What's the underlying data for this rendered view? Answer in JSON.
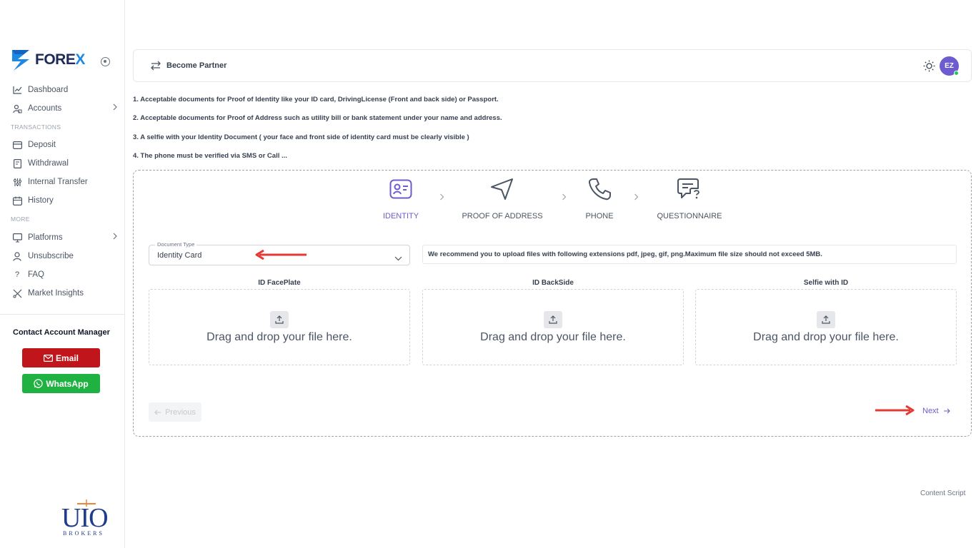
{
  "sidebar": {
    "logo_prefix": "FORE",
    "logo_x": "X",
    "items": [
      {
        "label": "Dashboard",
        "icon": "chart-icon"
      },
      {
        "label": "Accounts",
        "icon": "user-lock-icon"
      },
      {
        "label": "Deposit",
        "icon": "card-icon"
      },
      {
        "label": "Withdrawal",
        "icon": "receipt-icon"
      },
      {
        "label": "Internal Transfer",
        "icon": "sliders-icon"
      },
      {
        "label": "History",
        "icon": "calendar-icon"
      },
      {
        "label": "Platforms",
        "icon": "monitor-icon"
      },
      {
        "label": "Unsubscribe",
        "icon": "user-icon"
      },
      {
        "label": "FAQ",
        "icon": "question-icon"
      },
      {
        "label": "Market Insights",
        "icon": "tools-icon"
      }
    ],
    "section_transactions": "TRANSACTIONS",
    "section_more": "MORE",
    "contact_title": "Contact Account Manager",
    "email_label": "Email",
    "whatsapp_label": "WhatsApp",
    "brand_text": "UIO",
    "brand_sub": "BROKERS"
  },
  "header": {
    "become_partner": "Become Partner",
    "avatar_initials": "EZ"
  },
  "notes": [
    "1. Acceptable documents for Proof of Identity like your ID card, DrivingLicense (Front and back side) or Passport.",
    "2. Acceptable documents for Proof of Address such as utility bill or bank statement under your name and address.",
    "3. A selfie with your Identity Document ( your face and front side of identity card must be clearly visible )",
    "4. The phone must be verified via SMS or Call ..."
  ],
  "steps": [
    {
      "label": "IDENTITY",
      "icon": "id-card-icon",
      "active": true
    },
    {
      "label": "PROOF OF ADDRESS",
      "icon": "navigation-icon",
      "active": false
    },
    {
      "label": "PHONE",
      "icon": "phone-icon",
      "active": false
    },
    {
      "label": "QUESTIONNAIRE",
      "icon": "message-question-icon",
      "active": false
    }
  ],
  "document_type": {
    "legend": "Document Type",
    "value": "Identity Card"
  },
  "recommendation": "We recommend you to upload files with following extensions pdf, jpeg, gif, png.Maximum file size should not exceed 5MB.",
  "uploads": [
    {
      "label": "ID FacePlate",
      "drop_text": "Drag and drop your file here."
    },
    {
      "label": "ID BackSide",
      "drop_text": "Drag and drop your file here."
    },
    {
      "label": "Selfie with ID",
      "drop_text": "Drag and drop your file here."
    }
  ],
  "nav_buttons": {
    "previous": "Previous",
    "next": "Next"
  },
  "footer": "Content Script",
  "colors": {
    "accent": "#6d5bd0",
    "email": "#c0161b",
    "whatsapp": "#1fb141",
    "arrow": "#e53935"
  }
}
